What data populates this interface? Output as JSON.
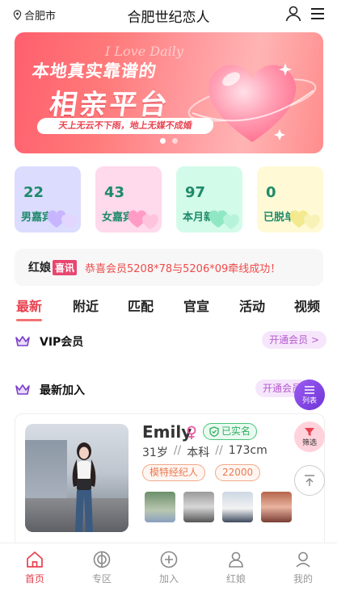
{
  "header": {
    "location": "合肥市",
    "title": "合肥世纪恋人"
  },
  "banner": {
    "script_text": "I Love Daily",
    "headline": "本地真实靠谱的",
    "main": "相亲平台",
    "tagline": "天上无云不下雨，地上无媒不成婚"
  },
  "stats": [
    {
      "count": "22",
      "label": "男嘉宾",
      "bg": "#dcdcff",
      "fg": "#1e8a6a"
    },
    {
      "count": "43",
      "label": "女嘉宾",
      "bg": "#ffd9ec",
      "fg": "#1e8a6a"
    },
    {
      "count": "97",
      "label": "本月新人",
      "bg": "#d3fbe9",
      "fg": "#1e8a6a"
    },
    {
      "count": "0",
      "label": "已脱单",
      "bg": "#fffad5",
      "fg": "#1e8a6a"
    }
  ],
  "notice": {
    "label": "红娘",
    "badge": "喜讯",
    "message": "恭喜会员5208*78与5206*09牵线成功！"
  },
  "tabs": [
    "最新",
    "附近",
    "匹配",
    "官宣",
    "活动",
    "视频"
  ],
  "sections": {
    "vip": {
      "title": "VIP会员",
      "action": "开通会员 >"
    },
    "new": {
      "title": "最新加入",
      "action": "开通会员"
    }
  },
  "profile": {
    "name": "Emily",
    "verified": "已实名",
    "age": "31岁",
    "education": "本科",
    "height": "173cm",
    "occupation": "模特经纪人",
    "income": "22000"
  },
  "floating": {
    "list": "列表",
    "filter": "筛选"
  },
  "bottom_nav": [
    {
      "label": "首页",
      "icon": "home-icon",
      "active": true
    },
    {
      "label": "专区",
      "icon": "zone-icon",
      "active": false
    },
    {
      "label": "加入",
      "icon": "plus-icon",
      "active": false
    },
    {
      "label": "红娘",
      "icon": "matchmaker-icon",
      "active": false
    },
    {
      "label": "我的",
      "icon": "profile-icon",
      "active": false
    }
  ],
  "colors": {
    "accent": "#e8414f",
    "purple": "#8e4fdc"
  }
}
